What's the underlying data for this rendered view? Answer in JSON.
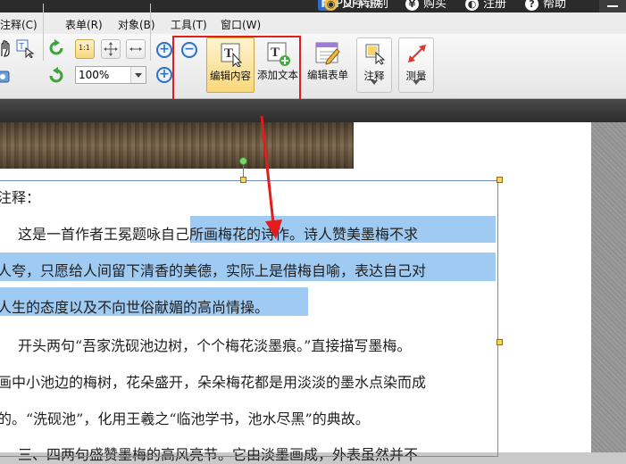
{
  "titlebar": {
    "items": [
      {
        "label": "PDF转换",
        "icon": "pdf-convert-icon",
        "glyph": "P"
      },
      {
        "label": "文字识别",
        "icon": "ocr-eye-icon",
        "glyph": "◉"
      },
      {
        "label": "购买",
        "icon": "buy-icon",
        "glyph": "¥"
      },
      {
        "label": "注册",
        "icon": "register-icon",
        "glyph": "◐"
      },
      {
        "label": "帮助",
        "icon": "help-icon",
        "glyph": "?"
      }
    ]
  },
  "menubar": {
    "items": [
      "注释(C)",
      "表单(R)",
      "对象(B)",
      "工具(T)",
      "窗口(W)"
    ]
  },
  "toolbar": {
    "zoom_value": "100%",
    "buttons": {
      "edit_content": "编辑内容",
      "add_text": "添加文本",
      "edit_form": "编辑表单",
      "annotate": "注释",
      "measure": "测量"
    },
    "colors": {
      "highlight_box": "#e31d1d",
      "active": "#f8d77c",
      "selection": "#9fcaf1"
    }
  },
  "document": {
    "lines": [
      "注释：",
      "这是一首作者王冕题咏自己所画梅花的诗作。诗人赞美墨梅不求",
      "人夸，只愿给人间留下清香的美德，实际上是借梅自喻，表达自己对",
      "人生的态度以及不向世俗献媚的高尚情操。",
      "开头两句“吾家洗砚池边树，个个梅花淡墨痕。”直接描写墨梅。",
      "画中小池边的梅树，花朵盛开，朵朵梅花都是用淡淡的墨水点染而成",
      "的。“洗砚池”，化用王羲之“临池学书，池水尽黑”的典故。",
      "三、四两句盛赞墨梅的高风亮节。它由淡墨画成，外表虽然并不"
    ]
  }
}
